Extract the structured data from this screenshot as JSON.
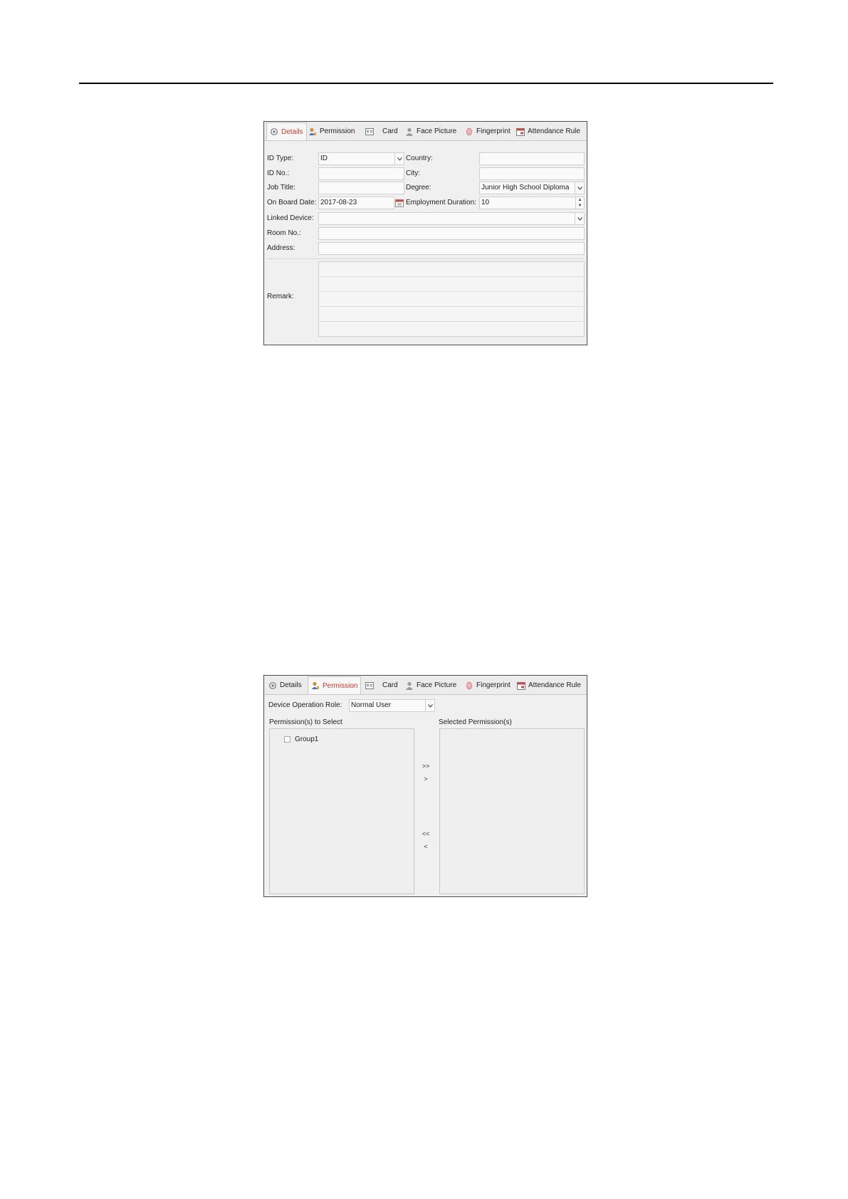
{
  "tabs": {
    "details": "Details",
    "permission": "Permission",
    "card": "Card",
    "face_picture": "Face Picture",
    "fingerprint": "Fingerprint",
    "attendance_rule": "Attendance Rule"
  },
  "details": {
    "id_type": {
      "label": "ID Type:",
      "value": "ID"
    },
    "country": {
      "label": "Country:",
      "value": ""
    },
    "id_no": {
      "label": "ID No.:",
      "value": ""
    },
    "city": {
      "label": "City:",
      "value": ""
    },
    "job_title": {
      "label": "Job Title:",
      "value": ""
    },
    "degree": {
      "label": "Degree:",
      "value": "Junior High School Diploma"
    },
    "on_board_date": {
      "label": "On Board Date:",
      "value": "2017-08-23"
    },
    "employment_duration": {
      "label": "Employment Duration:",
      "value": "10"
    },
    "linked_device": {
      "label": "Linked Device:",
      "value": ""
    },
    "room_no": {
      "label": "Room No.:",
      "value": ""
    },
    "address": {
      "label": "Address:",
      "value": ""
    },
    "remark": {
      "label": "Remark:"
    }
  },
  "permission": {
    "device_operation_role": {
      "label": "Device Operation Role:",
      "value": "Normal User"
    },
    "to_select_label": "Permission(s) to Select",
    "selected_label": "Selected Permission(s)",
    "items": [
      {
        "label": "Group1",
        "checked": false
      }
    ],
    "buttons": {
      "add_all": ">>",
      "add": ">",
      "remove_all": "<<",
      "remove": "<"
    }
  },
  "colors": {
    "active_tab": "#c0392b",
    "panel_bg": "#f0f0f0",
    "field_border": "#cfcfcf"
  }
}
